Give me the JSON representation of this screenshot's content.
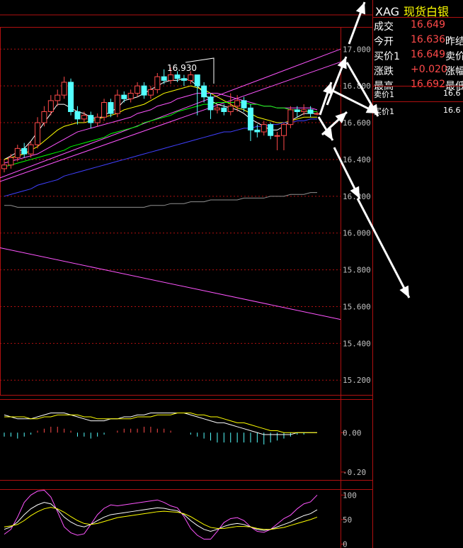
{
  "instrument": {
    "code": "XAG",
    "name": "现货白银"
  },
  "quote": {
    "rows": [
      {
        "label": "成交",
        "value": "16.649",
        "label2": ""
      },
      {
        "label": "今开",
        "value": "16.636",
        "label2": "昨结"
      },
      {
        "label": "买价1",
        "value": "16.649",
        "label2": "卖价"
      },
      {
        "label": "涨跌",
        "value": "+0.020",
        "label2": "涨幅"
      },
      {
        "label": "最高",
        "value": "16.692",
        "label2": "最低"
      }
    ],
    "ask": {
      "label": "卖价1",
      "value": "16.6"
    },
    "bid": {
      "label": "买价1",
      "value": "16.6"
    }
  },
  "colors": {
    "up": "#ff4a4a",
    "down": "#54ffff",
    "grid": "#b01010",
    "ma5": "#ffffff",
    "ma10": "#ffff00",
    "ma20": "#ff55ff",
    "ma30": "#00ff00",
    "ma60": "#4040ff",
    "ma120": "#909090"
  },
  "chart_data": {
    "type": "candlestick",
    "main": {
      "y_ticks": [
        "17.000",
        "16.800",
        "16.600",
        "16.400",
        "16.200",
        "16.000",
        "15.800",
        "15.600",
        "15.400",
        "15.200"
      ],
      "ylim": [
        15.12,
        17.19
      ],
      "high_annotation": "16.930",
      "candles": [
        [
          16.35,
          16.37,
          16.33,
          16.4
        ],
        [
          16.37,
          16.41,
          16.35,
          16.43
        ],
        [
          16.41,
          16.46,
          16.39,
          16.48
        ],
        [
          16.46,
          16.43,
          16.41,
          16.49
        ],
        [
          16.43,
          16.48,
          16.41,
          16.5
        ],
        [
          16.48,
          16.6,
          16.46,
          16.63
        ],
        [
          16.6,
          16.66,
          16.58,
          16.69
        ],
        [
          16.66,
          16.72,
          16.64,
          16.75
        ],
        [
          16.72,
          16.75,
          16.69,
          16.78
        ],
        [
          16.75,
          16.82,
          16.73,
          16.85
        ],
        [
          16.82,
          16.66,
          16.64,
          16.84
        ],
        [
          16.66,
          16.62,
          16.59,
          16.69
        ],
        [
          16.62,
          16.64,
          16.6,
          16.66
        ],
        [
          16.64,
          16.6,
          16.57,
          16.66
        ],
        [
          16.6,
          16.63,
          16.58,
          16.65
        ],
        [
          16.63,
          16.71,
          16.61,
          16.73
        ],
        [
          16.71,
          16.65,
          16.63,
          16.73
        ],
        [
          16.65,
          16.75,
          16.63,
          16.78
        ],
        [
          16.75,
          16.73,
          16.71,
          16.77
        ],
        [
          16.73,
          16.76,
          16.71,
          16.78
        ],
        [
          16.76,
          16.8,
          16.74,
          16.82
        ],
        [
          16.8,
          16.75,
          16.73,
          16.82
        ],
        [
          16.75,
          16.78,
          16.73,
          16.8
        ],
        [
          16.78,
          16.85,
          16.76,
          16.87
        ],
        [
          16.85,
          16.83,
          16.81,
          16.89
        ],
        [
          16.83,
          16.86,
          16.81,
          16.9
        ],
        [
          16.86,
          16.84,
          16.82,
          16.88
        ],
        [
          16.84,
          16.83,
          16.8,
          16.86
        ],
        [
          16.83,
          16.86,
          16.81,
          16.88
        ],
        [
          16.86,
          16.8,
          16.64,
          16.86
        ],
        [
          16.8,
          16.74,
          16.71,
          16.82
        ],
        [
          16.74,
          16.67,
          16.62,
          16.76
        ],
        [
          16.67,
          16.68,
          16.65,
          16.7
        ],
        [
          16.68,
          16.66,
          16.64,
          16.7
        ],
        [
          16.66,
          16.69,
          16.64,
          16.76
        ],
        [
          16.69,
          16.72,
          16.66,
          16.75
        ],
        [
          16.72,
          16.68,
          16.66,
          16.74
        ],
        [
          16.68,
          16.56,
          16.5,
          16.7
        ],
        [
          16.56,
          16.55,
          16.52,
          16.59
        ],
        [
          16.55,
          16.59,
          16.53,
          16.61
        ],
        [
          16.59,
          16.53,
          16.51,
          16.6
        ],
        [
          16.53,
          16.53,
          16.45,
          16.55
        ],
        [
          16.53,
          16.59,
          16.45,
          16.6
        ],
        [
          16.59,
          16.67,
          16.57,
          16.69
        ],
        [
          16.67,
          16.66,
          16.63,
          16.69
        ],
        [
          16.66,
          16.67,
          16.64,
          16.7
        ],
        [
          16.67,
          16.65,
          16.63,
          16.69
        ],
        [
          16.65,
          16.65,
          16.64,
          16.66
        ]
      ],
      "series": [
        {
          "name": "MA5",
          "color": "#ffffff",
          "values": [
            16.4,
            16.42,
            16.44,
            16.46,
            16.5,
            16.55,
            16.6,
            16.65,
            16.7,
            16.7,
            16.68,
            16.66,
            16.65,
            16.63,
            16.62,
            16.64,
            16.66,
            16.68,
            16.72,
            16.73,
            16.74,
            16.76,
            16.78,
            16.8,
            16.82,
            16.83,
            16.83,
            16.84,
            16.83,
            16.8,
            16.76,
            16.72,
            16.7,
            16.69,
            16.68,
            16.67,
            16.65,
            16.62,
            16.6,
            16.58,
            16.56,
            16.56,
            16.58,
            16.61,
            16.63,
            16.65,
            16.65,
            16.65
          ]
        },
        {
          "name": "MA10",
          "color": "#ffff00",
          "values": [
            16.4,
            16.41,
            16.42,
            16.43,
            16.45,
            16.47,
            16.5,
            16.53,
            16.56,
            16.58,
            16.59,
            16.6,
            16.6,
            16.61,
            16.62,
            16.63,
            16.64,
            16.65,
            16.67,
            16.68,
            16.69,
            16.7,
            16.72,
            16.74,
            16.76,
            16.77,
            16.78,
            16.79,
            16.8,
            16.79,
            16.78,
            16.76,
            16.74,
            16.72,
            16.7,
            16.68,
            16.67,
            16.65,
            16.63,
            16.62,
            16.61,
            16.6,
            16.6,
            16.61,
            16.62,
            16.63,
            16.63,
            16.63
          ]
        },
        {
          "name": "MA20",
          "color": "#ff55ff",
          "values": [
            16.38,
            16.39,
            16.4,
            16.41,
            16.42,
            16.43,
            16.45,
            16.47,
            16.49,
            16.51,
            16.53,
            16.55,
            16.56,
            16.57,
            16.58,
            16.59,
            16.6,
            16.61,
            16.62,
            16.63,
            16.65,
            16.66,
            16.67,
            16.69,
            16.7,
            16.71,
            16.73,
            16.74,
            16.75,
            16.76,
            16.76,
            16.76,
            16.76,
            16.75,
            16.74,
            16.73,
            16.72,
            16.71,
            16.7,
            16.69,
            16.69,
            16.68,
            16.68,
            16.68,
            16.68,
            16.68,
            16.68,
            16.67
          ]
        },
        {
          "name": "MA30",
          "color": "#00ff00",
          "values": [
            16.36,
            16.37,
            16.38,
            16.39,
            16.4,
            16.41,
            16.42,
            16.43,
            16.44,
            16.45,
            16.47,
            16.48,
            16.49,
            16.5,
            16.51,
            16.52,
            16.54,
            16.55,
            16.56,
            16.57,
            16.58,
            16.6,
            16.61,
            16.62,
            16.63,
            16.64,
            16.66,
            16.67,
            16.68,
            16.69,
            16.7,
            16.7,
            16.71,
            16.71,
            16.71,
            16.71,
            16.71,
            16.7,
            16.7,
            16.69,
            16.69,
            16.68,
            16.68,
            16.67,
            16.67,
            16.66,
            16.66,
            16.66
          ]
        },
        {
          "name": "MA60",
          "color": "#4040ff",
          "values": [
            16.2,
            16.21,
            16.22,
            16.23,
            16.24,
            16.26,
            16.27,
            16.28,
            16.29,
            16.31,
            16.32,
            16.33,
            16.34,
            16.35,
            16.36,
            16.37,
            16.38,
            16.39,
            16.4,
            16.41,
            16.42,
            16.43,
            16.44,
            16.45,
            16.46,
            16.47,
            16.48,
            16.49,
            16.5,
            16.51,
            16.52,
            16.53,
            16.54,
            16.55,
            16.55,
            16.56,
            16.57,
            16.57,
            16.58,
            16.58,
            16.59,
            16.59,
            16.6,
            16.6,
            16.61,
            16.61,
            16.62,
            16.62
          ]
        },
        {
          "name": "MA120",
          "color": "#909090",
          "values": [
            16.15,
            16.15,
            16.14,
            16.14,
            16.14,
            16.14,
            16.14,
            16.14,
            16.14,
            16.14,
            16.14,
            16.14,
            16.14,
            16.14,
            16.14,
            16.14,
            16.14,
            16.14,
            16.14,
            16.14,
            16.14,
            16.14,
            16.15,
            16.15,
            16.15,
            16.16,
            16.16,
            16.16,
            16.17,
            16.17,
            16.17,
            16.18,
            16.18,
            16.18,
            16.18,
            16.18,
            16.19,
            16.19,
            16.19,
            16.19,
            16.2,
            16.2,
            16.2,
            16.21,
            16.21,
            16.21,
            16.22,
            16.22
          ]
        }
      ],
      "trendlines": [
        {
          "color": "#ff55ff",
          "points": [
            [
              0,
              16.3
            ],
            [
              47,
              17.0
            ]
          ]
        },
        {
          "color": "#ff55ff",
          "points": [
            [
              0,
              16.28
            ],
            [
              47,
              16.93
            ]
          ]
        },
        {
          "color": "#ff55ff",
          "points": [
            [
              0,
              15.92
            ],
            [
              47,
              15.53
            ]
          ]
        }
      ]
    },
    "macd": {
      "y_ticks": [
        "0.00",
        "-0.20"
      ],
      "ylim": [
        -0.24,
        0.17
      ],
      "dif": [
        0.09,
        0.08,
        0.07,
        0.07,
        0.07,
        0.08,
        0.09,
        0.1,
        0.1,
        0.1,
        0.09,
        0.08,
        0.07,
        0.06,
        0.06,
        0.06,
        0.07,
        0.07,
        0.08,
        0.08,
        0.09,
        0.09,
        0.1,
        0.1,
        0.1,
        0.1,
        0.1,
        0.1,
        0.09,
        0.08,
        0.07,
        0.06,
        0.05,
        0.05,
        0.04,
        0.03,
        0.02,
        0.01,
        0.0,
        -0.01,
        -0.01,
        -0.01,
        -0.01,
        -0.01,
        0.0,
        0.0,
        0.0,
        0.0
      ],
      "dea": [
        0.08,
        0.08,
        0.08,
        0.08,
        0.07,
        0.07,
        0.08,
        0.08,
        0.09,
        0.09,
        0.09,
        0.09,
        0.08,
        0.08,
        0.07,
        0.07,
        0.07,
        0.07,
        0.07,
        0.07,
        0.08,
        0.08,
        0.08,
        0.09,
        0.09,
        0.09,
        0.1,
        0.1,
        0.1,
        0.09,
        0.09,
        0.08,
        0.08,
        0.07,
        0.06,
        0.05,
        0.05,
        0.04,
        0.03,
        0.02,
        0.01,
        0.01,
        0.0,
        0.0,
        0.0,
        0.0,
        0.0,
        0.0
      ],
      "hist": [
        -0.02,
        -0.02,
        -0.03,
        -0.02,
        -0.01,
        0.01,
        0.02,
        0.03,
        0.03,
        0.02,
        0.01,
        -0.02,
        -0.02,
        -0.03,
        -0.02,
        -0.01,
        0.0,
        0.01,
        0.02,
        0.02,
        0.02,
        0.03,
        0.03,
        0.02,
        0.02,
        0.01,
        0.0,
        0.0,
        -0.01,
        -0.02,
        -0.03,
        -0.04,
        -0.05,
        -0.05,
        -0.05,
        -0.05,
        -0.05,
        -0.05,
        -0.05,
        -0.06,
        -0.05,
        -0.04,
        -0.03,
        -0.02,
        -0.01,
        -0.01,
        0.0,
        0.0
      ]
    },
    "kdj": {
      "y_ticks": [
        "100",
        "50",
        "0"
      ],
      "ylim": [
        -8,
        112
      ],
      "k": [
        30,
        35,
        45,
        60,
        72,
        80,
        85,
        82,
        70,
        55,
        45,
        38,
        35,
        40,
        48,
        55,
        60,
        62,
        64,
        66,
        68,
        70,
        72,
        74,
        73,
        70,
        68,
        60,
        48,
        38,
        30,
        26,
        30,
        36,
        40,
        42,
        40,
        35,
        30,
        28,
        30,
        35,
        40,
        45,
        52,
        58,
        62,
        70
      ],
      "d": [
        35,
        37,
        40,
        48,
        58,
        66,
        72,
        75,
        72,
        65,
        56,
        48,
        42,
        40,
        42,
        46,
        50,
        54,
        56,
        58,
        60,
        62,
        64,
        66,
        67,
        66,
        65,
        62,
        56,
        48,
        40,
        34,
        32,
        32,
        34,
        36,
        36,
        35,
        32,
        30,
        30,
        32,
        34,
        38,
        42,
        46,
        50,
        55
      ],
      "j": [
        20,
        30,
        55,
        85,
        100,
        108,
        110,
        96,
        66,
        35,
        23,
        18,
        21,
        40,
        60,
        73,
        80,
        78,
        80,
        82,
        84,
        86,
        88,
        90,
        85,
        78,
        74,
        56,
        32,
        18,
        10,
        10,
        26,
        44,
        52,
        54,
        48,
        35,
        26,
        24,
        30,
        41,
        52,
        59,
        72,
        82,
        86,
        100
      ]
    }
  }
}
